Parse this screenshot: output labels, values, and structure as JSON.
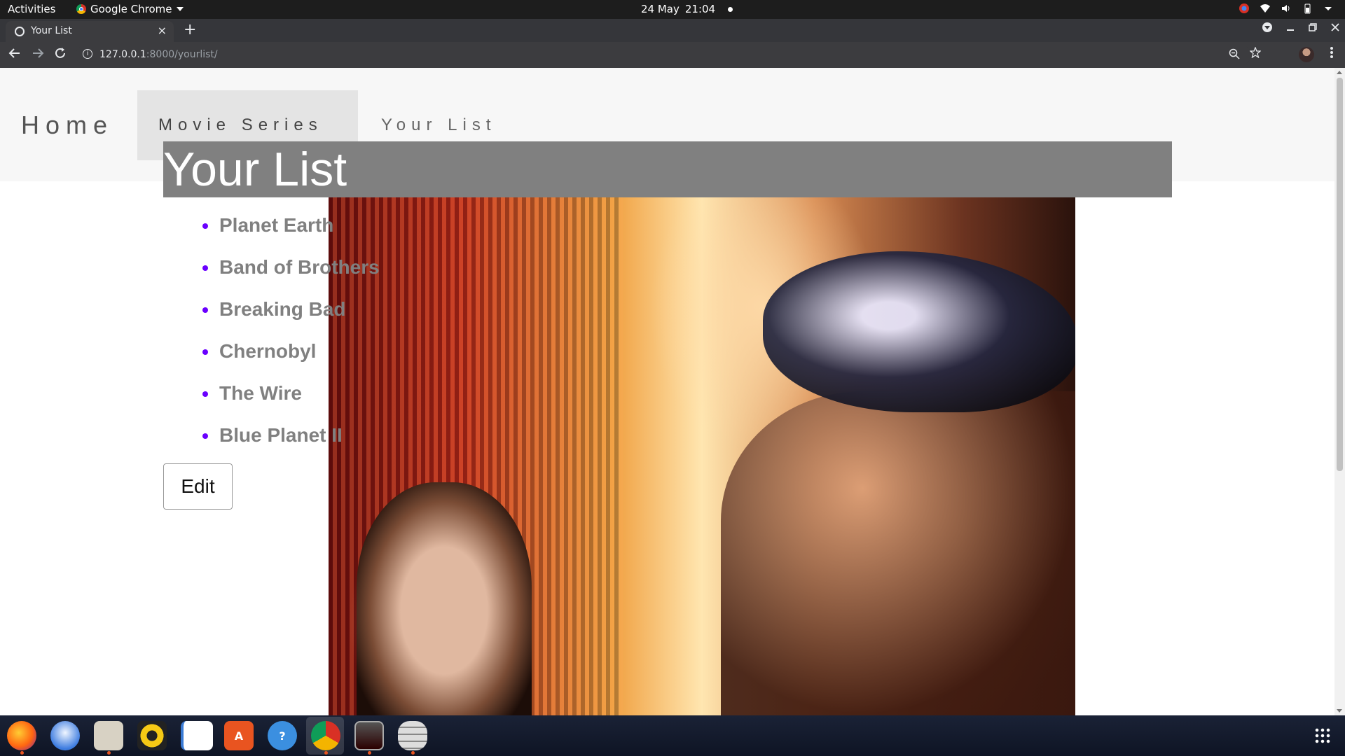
{
  "system": {
    "activities": "Activities",
    "app_name": "Google Chrome",
    "date": "24 May",
    "time": "21:04"
  },
  "browser": {
    "tab_title": "Your List",
    "close_symbol": "×",
    "newtab_symbol": "+",
    "url_host": "127.0.0.1",
    "url_path": ":8000/yourlist/",
    "info_symbol": "i"
  },
  "nav": {
    "home": "Home",
    "movie_series": "Movie Series",
    "your_list": "Your List"
  },
  "main": {
    "heading": "Your List",
    "items": [
      "Planet Earth",
      "Band of Brothers",
      "Breaking Bad",
      "Chernobyl",
      "The Wire",
      "Blue Planet II"
    ],
    "edit_label": "Edit"
  },
  "colors": {
    "heading_bg": "#808080",
    "bullet": "#6a00ff",
    "item_text": "#808080"
  },
  "dock": {
    "apps": [
      "firefox-icon",
      "thunderbird-icon",
      "files-icon",
      "rhythmbox-icon",
      "writer-icon",
      "software-icon",
      "help-icon",
      "chrome-icon",
      "terminal-icon",
      "disks-icon"
    ]
  }
}
